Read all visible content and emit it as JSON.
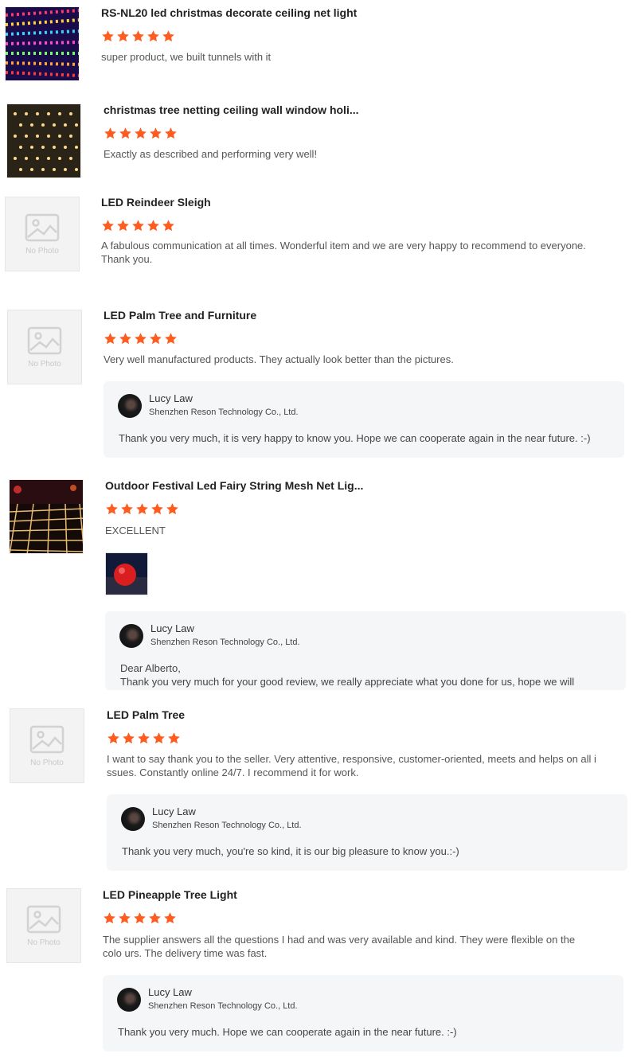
{
  "colors": {
    "star": "#ff5c1f",
    "reply_bg": "#f5f6f8"
  },
  "reviews": [
    {
      "title": "RS-NL20 led christmas decorate ceiling net light",
      "rating": 5,
      "comment": "super product, we built tunnels with it",
      "thumb": "photo-multicolor-net-lights"
    },
    {
      "title": "christmas tree netting ceiling wall window holi...",
      "rating": 5,
      "comment": "Exactly as described and performing very well!",
      "thumb": "photo-warm-net-lights"
    },
    {
      "title": "LED Reindeer Sleigh",
      "rating": 5,
      "comment": "A fabulous communication at all times. Wonderful item and we are very happy to recommend to everyone. Thank you.",
      "thumb": "no-photo",
      "no_photo_label": "No Photo"
    },
    {
      "title": "LED Palm Tree and Furniture",
      "rating": 5,
      "comment": "Very well manufactured products. They actually look better than the pictures.",
      "thumb": "no-photo",
      "no_photo_label": "No Photo",
      "reply": {
        "name": "Lucy Law",
        "company": "Shenzhen Reson Technology Co., Ltd.",
        "text": "Thank you very much, it is very happy to know you. Hope we can cooperate again in the near future. :-)"
      }
    },
    {
      "title": "Outdoor Festival Led Fairy String Mesh Net Lig...",
      "rating": 5,
      "comment": "EXCELLENT",
      "thumb": "photo-outdoor-net-lights",
      "attachment": "photo-red-ball-light",
      "reply": {
        "name": "Lucy Law",
        "company": "Shenzhen Reson Technology Co., Ltd.",
        "text": "Dear Alberto,\nThank you very much for your good review, we really appreciate what you done for us, hope we will"
      }
    },
    {
      "title": "LED Palm Tree",
      "rating": 5,
      "comment": "I want to say thank you to the seller. Very attentive, responsive, customer-oriented, meets and helps on all i ssues. Constantly online 24/7. I recommend it for work.",
      "thumb": "no-photo",
      "no_photo_label": "No Photo",
      "reply": {
        "name": "Lucy Law",
        "company": "Shenzhen Reson Technology Co., Ltd.",
        "text": "Thank you very much, you're so kind, it is our big pleasure to know you.:-)"
      }
    },
    {
      "title": "LED Pineapple Tree Light",
      "rating": 5,
      "comment": "The supplier answers all the questions I had and was very available and kind. They were flexible on the colo urs. The delivery time was fast.",
      "thumb": "no-photo",
      "no_photo_label": "No Photo",
      "reply": {
        "name": "Lucy Law",
        "company": "Shenzhen Reson Technology Co., Ltd.",
        "text": "Thank you very much. Hope we can cooperate again in the near future. :-)"
      }
    }
  ]
}
